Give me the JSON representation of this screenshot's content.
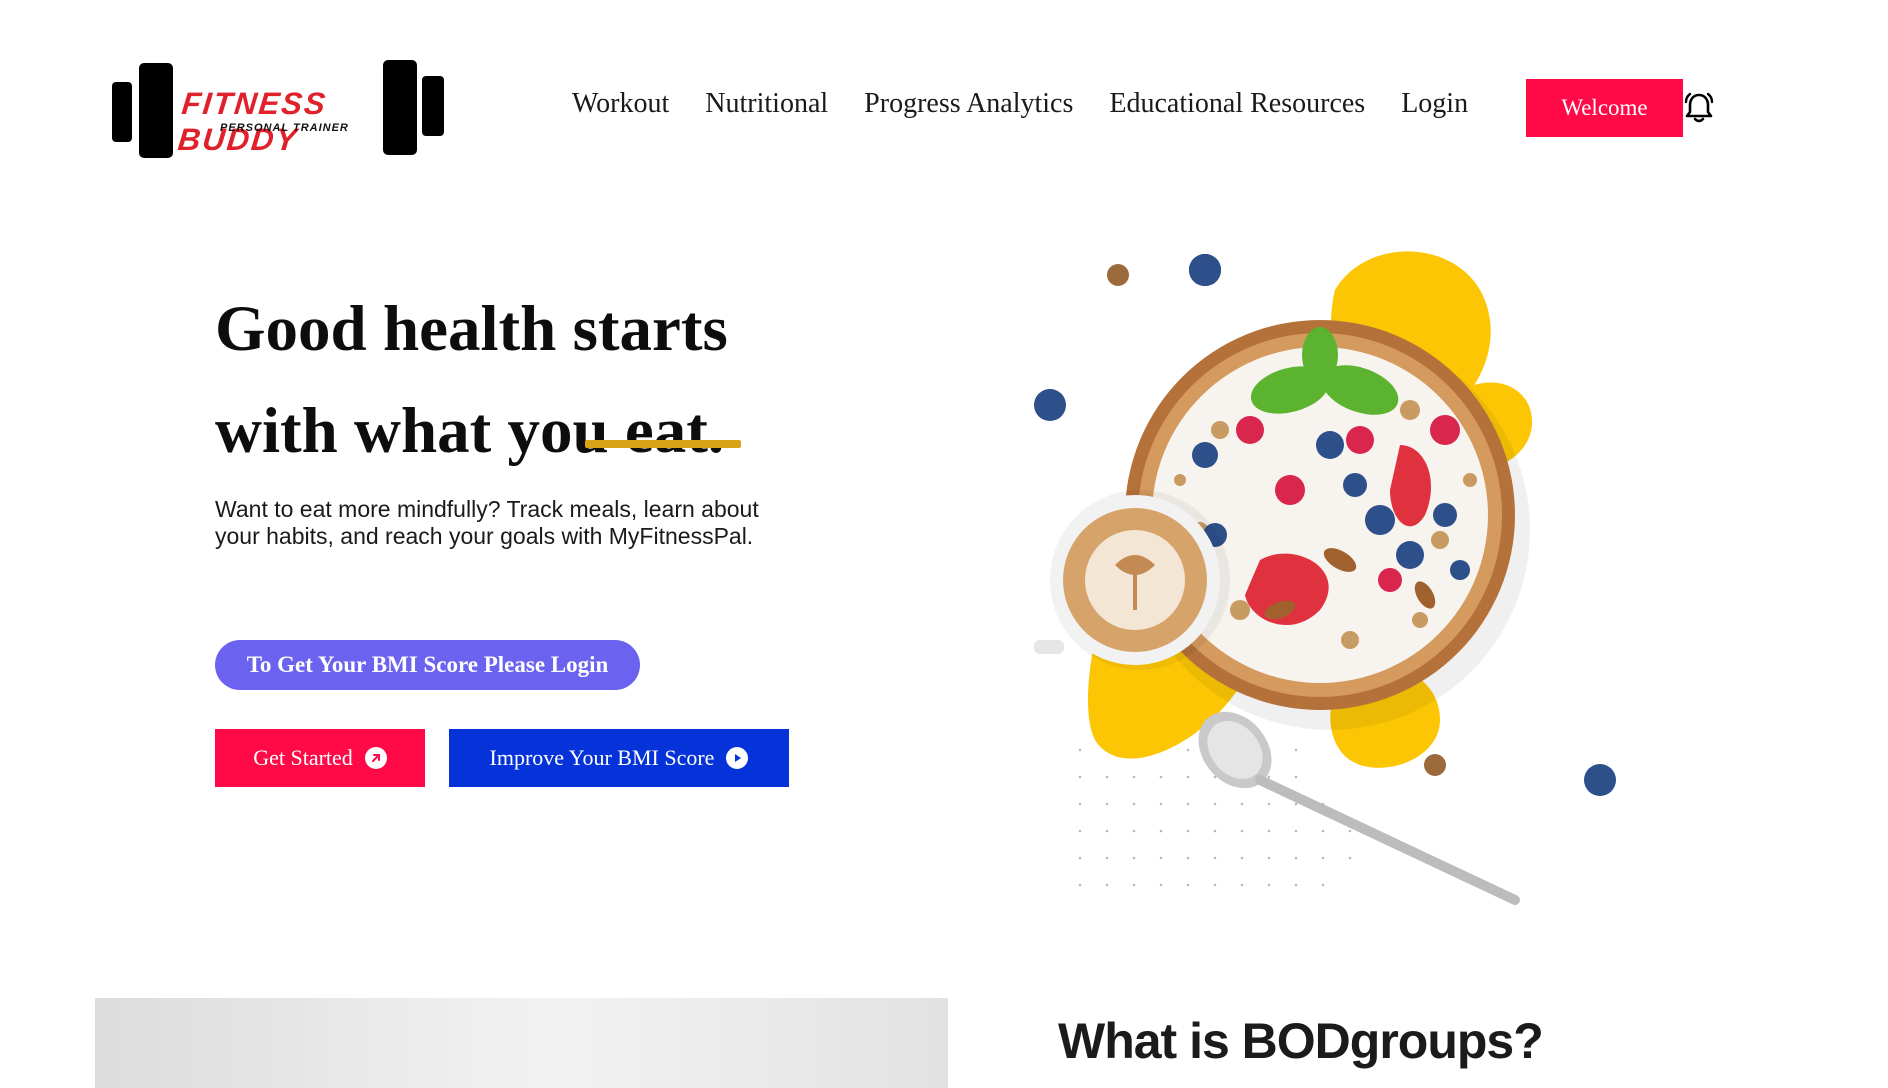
{
  "brand": {
    "name": "FITNESS BUDDY",
    "tagline": "PERSONAL TRAINER",
    "accent_color": "#e0202a"
  },
  "nav": {
    "items": [
      {
        "label": "Workout"
      },
      {
        "label": "Nutritional"
      },
      {
        "label": "Progress Analytics"
      },
      {
        "label": "Educational Resources"
      },
      {
        "label": "Login"
      }
    ],
    "welcome_label": "Welcome",
    "notification_icon": "bell-icon"
  },
  "hero": {
    "title_line1": "Good health starts",
    "title_line2": "with what you eat.",
    "lead": "Want to eat more mindfully? Track meals, learn about your habits, and reach your goals with MyFitnessPal.",
    "bmi_notice": "To Get Your BMI Score Please Login",
    "get_started_label": "Get Started",
    "get_started_icon": "arrow-up-right-icon",
    "improve_label": "Improve Your BMI Score",
    "improve_icon": "play-circle-icon",
    "colors": {
      "primary": "#ff0a47",
      "secondary": "#0533d9",
      "pill": "#6b63f0",
      "underline": "#d8a318"
    }
  },
  "about": {
    "heading": "What is BODgroups?"
  }
}
